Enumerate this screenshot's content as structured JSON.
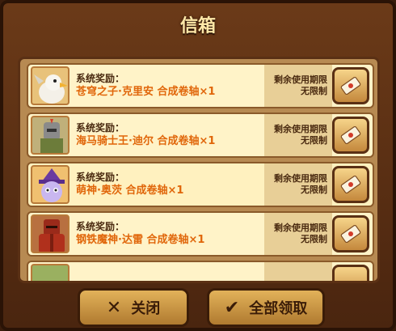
{
  "title": "信箱",
  "mail_items": [
    {
      "title": "系统奖励：",
      "item": "苍穹之子·克里安 合成卷轴×1",
      "limit_line1": "剩余使用期限",
      "limit_line2": "无限制",
      "avatar": "griffin-avatar"
    },
    {
      "title": "系统奖励：",
      "item": "海马骑士王·迪尔 合成卷轴×1",
      "limit_line1": "剩余使用期限",
      "limit_line2": "无限制",
      "avatar": "knight-avatar"
    },
    {
      "title": "系统奖励：",
      "item": "萌神·奥茨 合成卷轴×1",
      "limit_line1": "剩余使用期限",
      "limit_line2": "无限制",
      "avatar": "witch-cat-avatar"
    },
    {
      "title": "系统奖励：",
      "item": "钢铁魔神·达雷 合成卷轴×1",
      "limit_line1": "剩余使用期限",
      "limit_line2": "无限制",
      "avatar": "red-armor-avatar"
    }
  ],
  "buttons": {
    "close_label": "关闭",
    "claim_all_label": "全部领取"
  },
  "icons": {
    "close": "x-icon",
    "claim": "checkmark-icon",
    "scroll": "scroll-icon"
  },
  "colors": {
    "item_text": "#e0660a",
    "title_text": "#ffe8a8"
  }
}
